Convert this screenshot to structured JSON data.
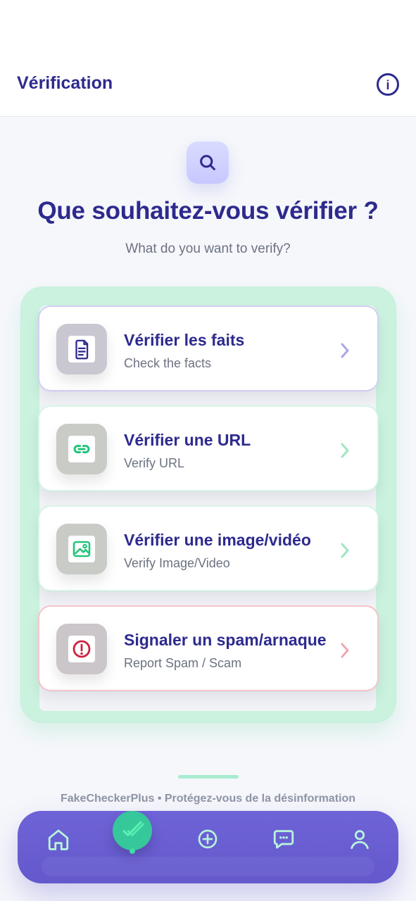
{
  "header": {
    "title": "Vérification",
    "info_glyph": "i"
  },
  "hero": {
    "title": "Que souhaitez-vous vérifier ?",
    "subtitle": "What do you want to verify?"
  },
  "options": [
    {
      "title": "Vérifier les faits",
      "subtitle": "Check the facts",
      "accent": "#7b76db",
      "icon": "document-icon"
    },
    {
      "title": "Vérifier une URL",
      "subtitle": "Verify URL",
      "accent": "#22c57c",
      "icon": "link-icon"
    },
    {
      "title": "Vérifier une image/vidéo",
      "subtitle": "Verify Image/Video",
      "accent": "#22c57c",
      "icon": "image-icon"
    },
    {
      "title": "Signaler un spam/arnaque",
      "subtitle": "Report Spam / Scam",
      "accent": "#d0213d",
      "icon": "alert-icon"
    }
  ],
  "footer": {
    "text": "FakeCheckerPlus • Protégez-vous de la désinformation"
  },
  "bottom_nav": {
    "items": [
      {
        "name": "home",
        "icon": "home-icon"
      },
      {
        "name": "verify",
        "icon": "double-check-icon"
      },
      {
        "name": "add",
        "icon": "plus-circle-icon"
      },
      {
        "name": "messages",
        "icon": "chat-icon"
      },
      {
        "name": "profile",
        "icon": "user-icon"
      }
    ]
  }
}
